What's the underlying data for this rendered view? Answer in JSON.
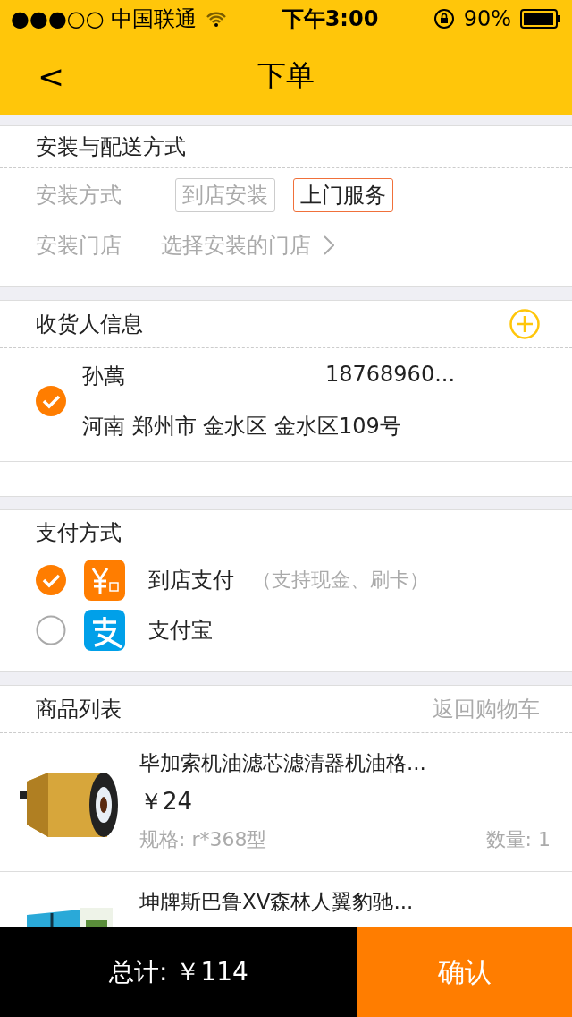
{
  "status_bar": {
    "carrier": "●●●○○ 中国联通",
    "time": "下午3:00",
    "battery": "90%"
  },
  "nav": {
    "back": "<",
    "title": "下单"
  },
  "install": {
    "title": "安装与配送方式",
    "method_label": "安装方式",
    "methods": [
      {
        "label": "到店安装",
        "selected": false
      },
      {
        "label": "上门服务",
        "selected": true
      }
    ],
    "store_label": "安装门店",
    "store_placeholder": "选择安装的门店"
  },
  "receiver": {
    "title": "收货人信息",
    "addresses": [
      {
        "name": "孙萬",
        "phone": "18768960...",
        "address": "河南 郑州市 金水区 金水区109号",
        "selected": true
      }
    ]
  },
  "payment": {
    "title": "支付方式",
    "methods": [
      {
        "kind": "cash",
        "label": "到店支付",
        "note": "（支持现金、刷卡）",
        "selected": true
      },
      {
        "kind": "alipay",
        "label": "支付宝",
        "selected": false
      }
    ]
  },
  "goods": {
    "title": "商品列表",
    "back_link": "返回购物车",
    "items": [
      {
        "kind": "filter",
        "name": "毕加索机油滤芯滤清器机油格...",
        "price": "￥24",
        "spec": "规格: r*368型",
        "qty": "数量: 1"
      },
      {
        "kind": "cabin",
        "name": "坤牌斯巴鲁XV森林人翼豹驰..."
      }
    ]
  },
  "footer": {
    "total": "总计: ￥114",
    "confirm": "确认"
  }
}
